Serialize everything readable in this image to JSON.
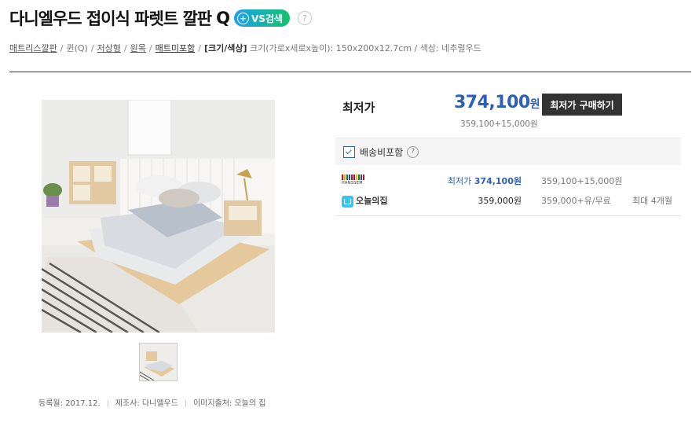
{
  "header": {
    "title": "다니엘우드 접이식 파렛트 깔판",
    "title_icon": "q-icon",
    "title_q": "Q",
    "vs_label": "VS검색",
    "help_glyph": "?"
  },
  "breadcrumb": {
    "items": [
      "매트리스깔판",
      "퀸(Q)",
      "저상형",
      "원목",
      "매트미포함"
    ],
    "spec_label": "[크기/색상]",
    "spec_text": "크기(가로x세로x높이): 150x200x12.7cm / 색상: 네추럴우드"
  },
  "product": {
    "register_label": "등록월: 2017.12.",
    "maker_label": "제조사: 다니엘우드",
    "image_source_label": "이미지출처: 오늘의 집"
  },
  "pricing": {
    "lowest_label": "최저가",
    "lowest_price": "374,100",
    "won": "원",
    "price_detail": "359,100+15,000원",
    "buy_button": "최저가 구매하기",
    "shipping_label": "배송비포함",
    "shipping_checked": true
  },
  "shops": [
    {
      "logo": "hanssem-logo",
      "logo_text": "HANSSEM",
      "price_prefix": "최저가",
      "price": "374,100원",
      "detail": "359,100+15,000원",
      "extra": "",
      "colors": [
        "#c8102e",
        "#f2a900",
        "#0a7d3e",
        "#1d4f91",
        "#c8102e",
        "#8a1538",
        "#f2a900",
        "#0a7d3e",
        "#1d4f91",
        "#c8102e"
      ]
    },
    {
      "logo": "ohouse-logo",
      "logo_text": "오늘의집",
      "price_prefix": "",
      "price": "359,000원",
      "detail": "359,000+유/무료",
      "extra": "최대 4개월"
    }
  ],
  "colors": {
    "accent_blue": "#2b5fb8",
    "buy_button_bg": "#333333",
    "vs_gradient": [
      "#1da1f2",
      "#13c26b"
    ]
  }
}
